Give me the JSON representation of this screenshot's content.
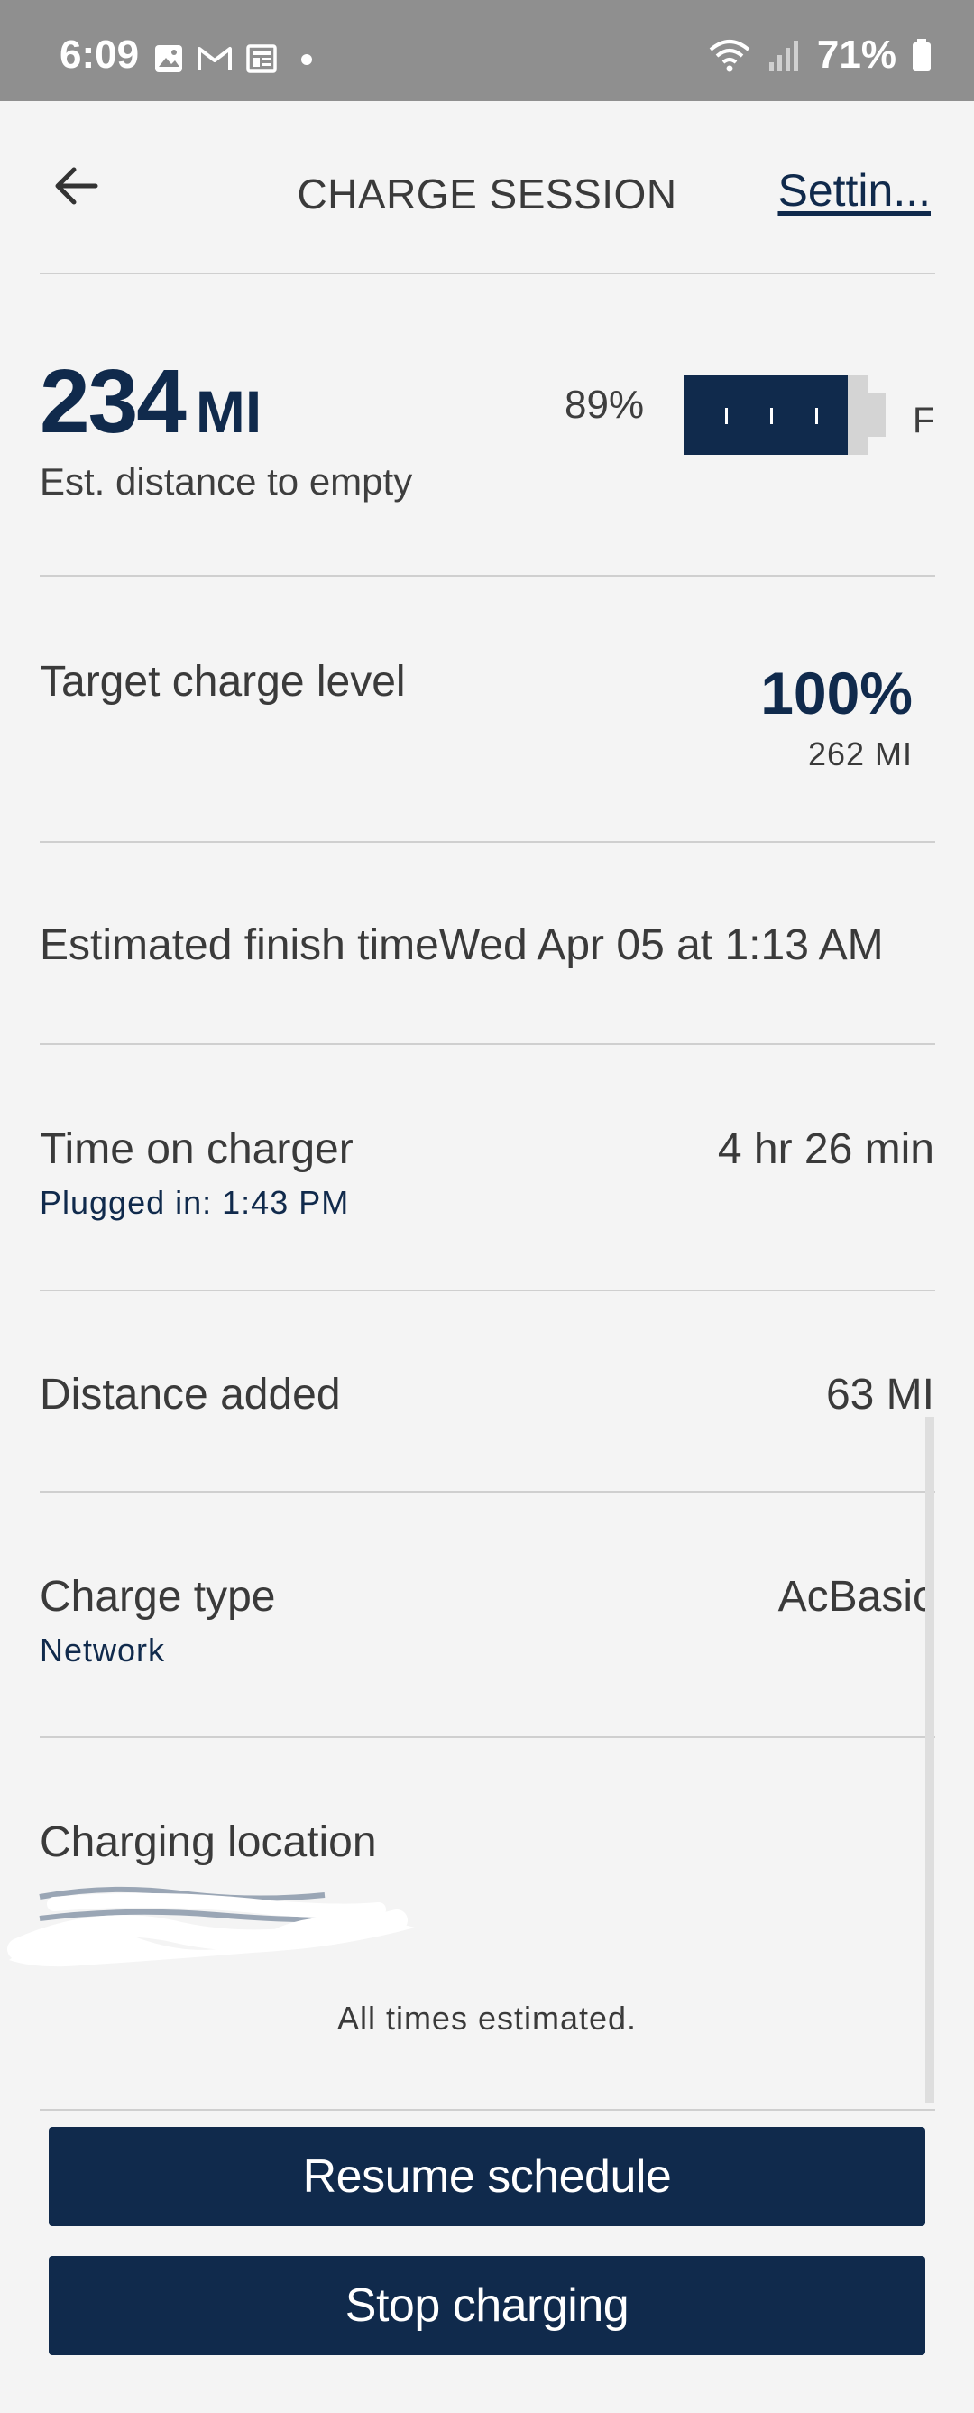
{
  "status_bar": {
    "time": "6:09",
    "battery": "71%",
    "icons_left": [
      "gallery-icon",
      "gmail-icon",
      "news-icon",
      "dot-icon"
    ],
    "icons_right": [
      "wifi-icon",
      "signal-icon",
      "battery-icon"
    ]
  },
  "header": {
    "title": "CHARGE SESSION",
    "settings_label": "Settin..."
  },
  "range": {
    "value": "234",
    "unit": "MI",
    "label": "Est. distance to empty",
    "battery_percent_text": "89%",
    "battery_level": 0.89,
    "full_label": "F"
  },
  "target": {
    "label": "Target charge level",
    "percent": "100%",
    "miles": "262 MI"
  },
  "finish": {
    "label": "Estimated finish time",
    "value": "Wed Apr 05 at 1:13 AM"
  },
  "time_on_charger": {
    "label": "Time on charger",
    "sub": "Plugged in: 1:43 PM",
    "value": "4 hr 26 min"
  },
  "distance_added": {
    "label": "Distance added",
    "value": "63 MI"
  },
  "charge_type": {
    "label": "Charge type",
    "sub": "Network",
    "value": "AcBasic"
  },
  "location": {
    "label": "Charging location"
  },
  "footnote": "All times estimated.",
  "buttons": {
    "resume": "Resume schedule",
    "stop": "Stop charging"
  },
  "colors": {
    "navy": "#102a4c",
    "background": "#f4f4f4",
    "status_bar": "#8f8f8f"
  }
}
